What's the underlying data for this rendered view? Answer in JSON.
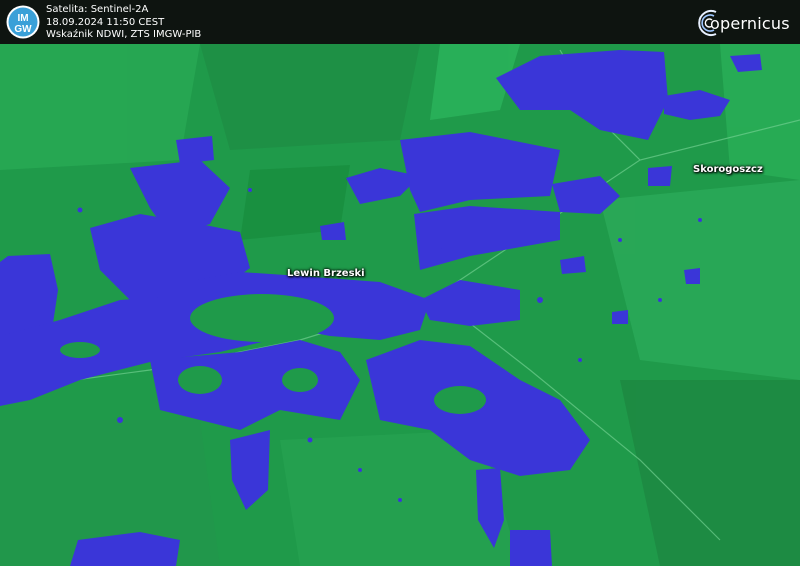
{
  "header": {
    "satellite": "Satelita: Sentinel-2A",
    "datetime": "18.09.2024 11:50 CEST",
    "index": "Wskaźnik NDWI, ZTS IMGW-PIB"
  },
  "logos": {
    "imgw_top": "IM",
    "imgw_bottom": "GW",
    "copernicus": "opernicus"
  },
  "places": {
    "lewin": "Lewin Brzeski",
    "skorogoszcz": "Skorogoszcz"
  },
  "colors": {
    "land": "#1f9a4a",
    "water": "#3a36d8",
    "header_bg": "#0e1410"
  }
}
